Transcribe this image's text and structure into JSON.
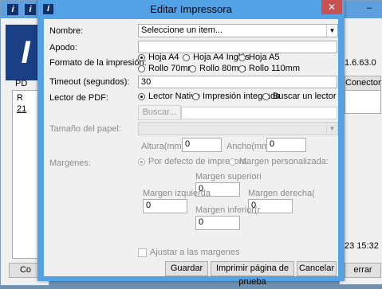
{
  "background": {
    "left_window": {
      "pd_label": "PD",
      "r_label": "R",
      "num_label": "21",
      "co_button": "Co"
    },
    "right_window": {
      "version": "1.6.63.0",
      "conector_button": "Conector",
      "time": "23 15:32",
      "cerrar_button": "errar"
    }
  },
  "dialog": {
    "title": "Editar Impressora",
    "close_glyph": "✕",
    "logo_glyph": "i",
    "nombre": {
      "label": "Nombre:",
      "value": "Seleccione un item..."
    },
    "apodo": {
      "label": "Apodo:",
      "value": ""
    },
    "formato": {
      "label": "Formato de la impresión:",
      "options": [
        "Hoja A4",
        "Hoja A4 Inglés",
        "Hoja A5",
        "Rollo 70mm",
        "Rollo 80mm",
        "Rollo 110mm"
      ],
      "selected": "Hoja A4"
    },
    "timeout": {
      "label": "Timeout (segundos):",
      "value": "30"
    },
    "lector": {
      "label": "Lector de PDF:",
      "options": [
        "Lector Nativo",
        "Impresión integrada",
        "Buscar un lector"
      ],
      "selected": "Lector Nativo",
      "buscar_button": "Buscar..."
    },
    "tamano": {
      "label": "Tamaño del papel:",
      "value": "",
      "altura_label": "Altura(mm):",
      "altura_value": "0",
      "ancho_label": "Ancho(mm):",
      "ancho_value": "0"
    },
    "margenes": {
      "label": "Margenes:",
      "opt_default": "Por defecto de impresora",
      "opt_custom": "Margen personalizada:",
      "superior_label": "Margen superiori",
      "superior_value": "0",
      "izquierda_label": "Margen izquierda",
      "izquierda_value": "0",
      "derecha_label": "Margen derecha(",
      "derecha_value": "0",
      "inferior_label": "Margen inferior(r",
      "inferior_value": "0"
    },
    "ajustar_label": "Ajustar a las margenes",
    "buttons": {
      "guardar": "Guardar",
      "imprimir": "Imprimir página de prueba",
      "cancelar": "Cancelar"
    }
  },
  "colors": {
    "titlebar": "#54a2e6",
    "close": "#c75050",
    "logo": "#10306e",
    "client": "#f0f0f0"
  }
}
